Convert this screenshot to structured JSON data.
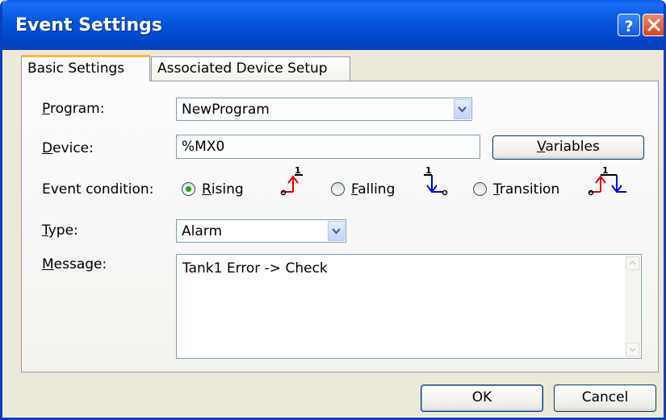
{
  "window": {
    "title": "Event Settings",
    "help_icon": "question-mark-icon",
    "close_icon": "close-x-icon"
  },
  "tabs": [
    {
      "label": "Basic Settings",
      "active": true
    },
    {
      "label": "Associated Device Setup",
      "active": false
    }
  ],
  "form": {
    "program_label": "Program:",
    "program_value": "NewProgram",
    "device_label": "Device:",
    "device_value": "%MX0",
    "variables_button": "Variables",
    "event_condition_label": "Event condition:",
    "rising_label": "Rising",
    "falling_label": "Falling",
    "transition_label": "Transition",
    "selected_condition": "Rising",
    "type_label": "Type:",
    "type_value": "Alarm",
    "message_label": "Message:",
    "message_value": "Tank1 Error -> Check"
  },
  "buttons": {
    "ok": "OK",
    "cancel": "Cancel"
  },
  "colors": {
    "titlebar": "#0054e3",
    "active_tab_accent": "#f9b944",
    "radio_dot": "#21a121",
    "rising_symbol": "#e00000",
    "falling_symbol": "#0000e0"
  }
}
